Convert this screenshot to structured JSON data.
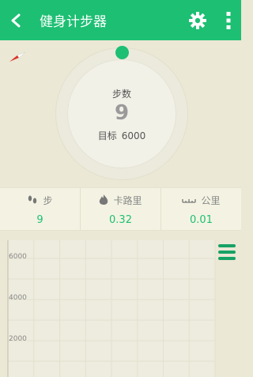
{
  "header": {
    "title": "健身计步器"
  },
  "summary": {
    "steps_label": "步数",
    "steps_value": "9",
    "goal_label": "目标",
    "goal_value": "6000"
  },
  "stats": [
    {
      "label": "步",
      "value": "9",
      "icon": "footprints-icon"
    },
    {
      "label": "卡路里",
      "value": "0.32",
      "icon": "flame-icon"
    },
    {
      "label": "公里",
      "value": "0.01",
      "icon": "ruler-icon"
    }
  ],
  "colors": {
    "accent": "#1dbf73",
    "background": "#ebe8d5"
  },
  "chart_data": {
    "type": "bar",
    "title": "",
    "xlabel": "",
    "ylabel": "",
    "y_ticks": [
      6000,
      4000,
      2000
    ],
    "ylim": [
      0,
      6500
    ],
    "grid": true,
    "series": []
  }
}
